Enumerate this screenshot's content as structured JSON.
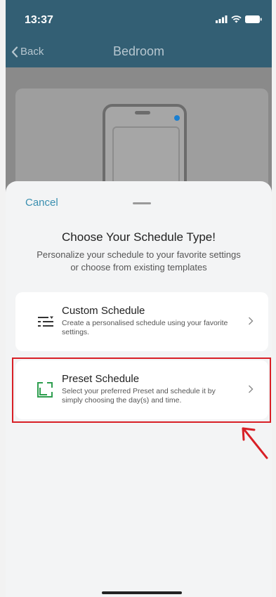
{
  "status": {
    "time": "13:37"
  },
  "nav": {
    "back_label": "Back",
    "title": "Bedroom"
  },
  "sheet": {
    "cancel_label": "Cancel",
    "title": "Choose Your Schedule Type!",
    "subtitle": "Personalize your schedule to your favorite settings or choose from existing templates",
    "options": [
      {
        "title": "Custom Schedule",
        "description": "Create a personalised schedule using your favorite settings.",
        "icon": "custom-list-icon"
      },
      {
        "title": "Preset Schedule",
        "description": "Select your preferred Preset and schedule it by simply choosing the day(s) and time.",
        "icon": "preset-frame-icon"
      }
    ]
  },
  "colors": {
    "header": "#335f74",
    "accent": "#3a8fb0",
    "preset_icon": "#2e9e4f",
    "highlight": "#d81f26"
  }
}
